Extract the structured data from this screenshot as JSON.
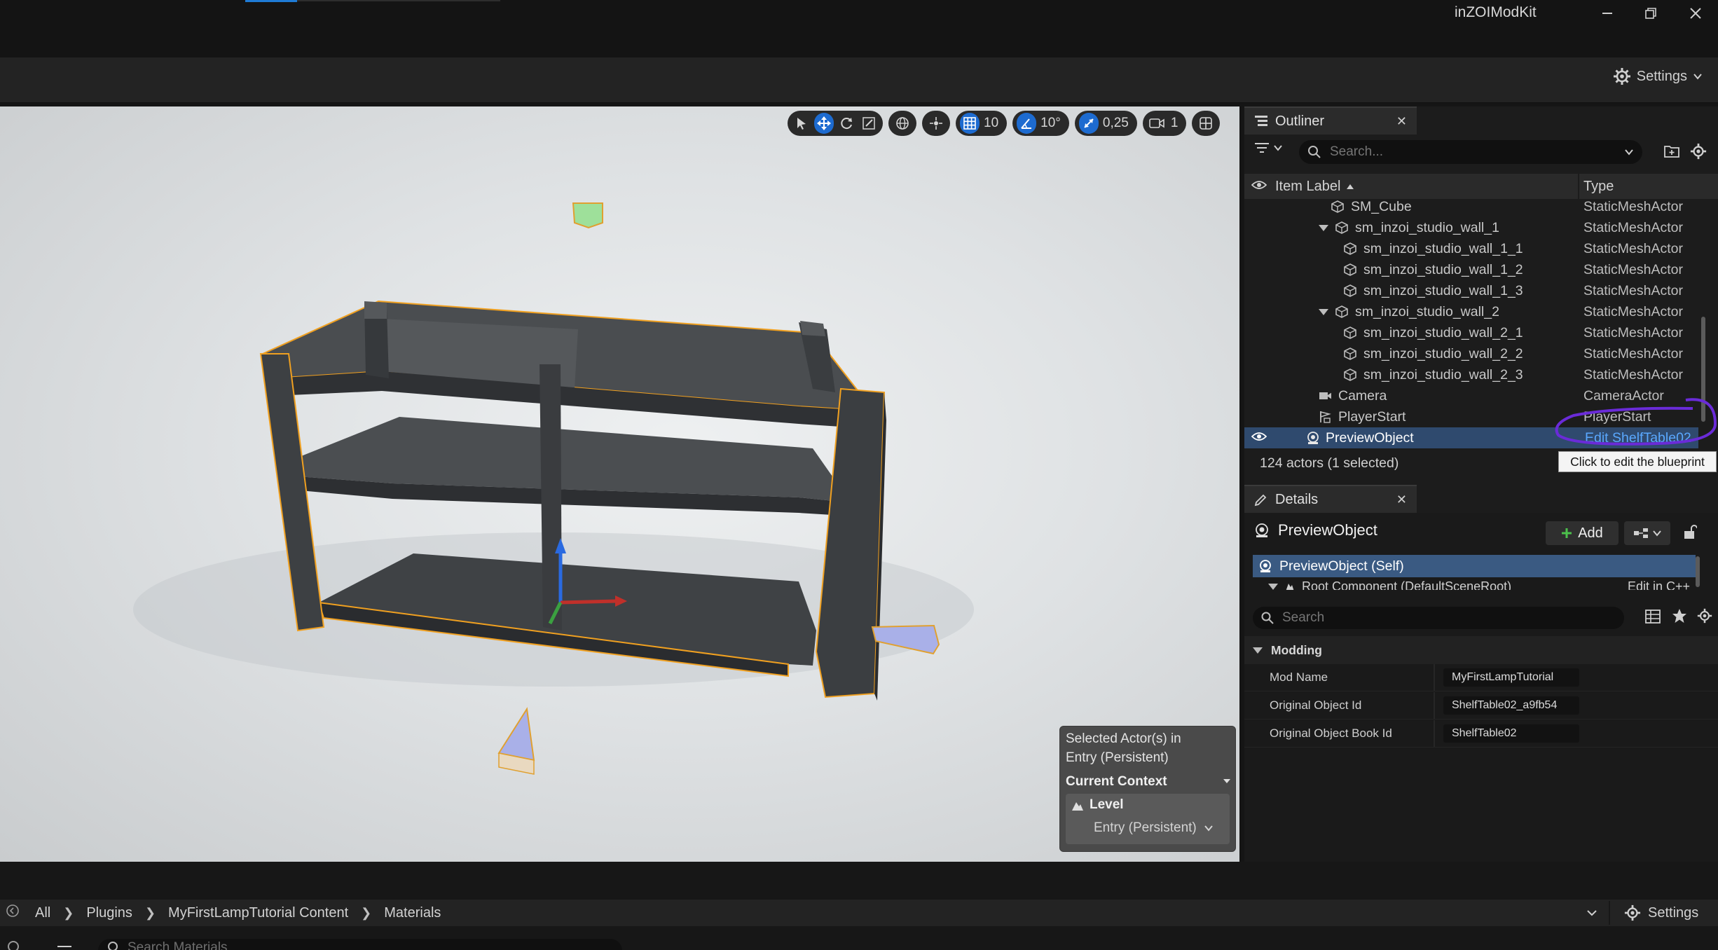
{
  "app": {
    "title": "inZOIModKit"
  },
  "toolbar": {
    "settings_label": "Settings"
  },
  "viewport_toolbar": {
    "grid_value": "10",
    "rotation_value": "10°",
    "scale_value": "0,25",
    "camera_speed": "1"
  },
  "level_context": {
    "info": "Selected Actor(s) in Entry (Persistent)",
    "current_context_label": "Current Context",
    "level_label": "Level",
    "level_value": "Entry (Persistent)"
  },
  "outliner": {
    "tab_label": "Outliner",
    "search_placeholder": "Search...",
    "col_label": "Item Label",
    "col_type": "Type",
    "rows": [
      {
        "label": "SM_Cube",
        "type": "StaticMeshActor"
      },
      {
        "label": "sm_inzoi_studio_wall_1",
        "type": "StaticMeshActor"
      },
      {
        "label": "sm_inzoi_studio_wall_1_1",
        "type": "StaticMeshActor"
      },
      {
        "label": "sm_inzoi_studio_wall_1_2",
        "type": "StaticMeshActor"
      },
      {
        "label": "sm_inzoi_studio_wall_1_3",
        "type": "StaticMeshActor"
      },
      {
        "label": "sm_inzoi_studio_wall_2",
        "type": "StaticMeshActor"
      },
      {
        "label": "sm_inzoi_studio_wall_2_1",
        "type": "StaticMeshActor"
      },
      {
        "label": "sm_inzoi_studio_wall_2_2",
        "type": "StaticMeshActor"
      },
      {
        "label": "sm_inzoi_studio_wall_2_3",
        "type": "StaticMeshActor"
      },
      {
        "label": "Camera",
        "type": "CameraActor"
      },
      {
        "label": "PlayerStart",
        "type": "PlayerStart"
      },
      {
        "label": "PreviewObject",
        "type": "Edit ShelfTable02"
      }
    ],
    "status": "124 actors (1 selected)",
    "tooltip": "Click to edit the blueprint"
  },
  "details": {
    "tab_label": "Details",
    "object_name": "PreviewObject",
    "add_label": "Add",
    "component_self": "PreviewObject (Self)",
    "component_root": "Root Component (DefaultSceneRoot)",
    "component_root_action": "Edit in C++",
    "search_placeholder": "Search",
    "section": "Modding",
    "props": [
      {
        "name": "Mod Name",
        "value": "MyFirstLampTutorial"
      },
      {
        "name": "Original Object Id",
        "value": "ShelfTable02_a9fb54"
      },
      {
        "name": "Original Object Book Id",
        "value": "ShelfTable02"
      }
    ]
  },
  "content_browser": {
    "breadcrumbs": [
      "All",
      "Plugins",
      "MyFirstLampTutorial Content",
      "Materials"
    ],
    "settings_label": "Settings",
    "search_placeholder": "Search Materials"
  },
  "colors": {
    "accent": "#1d6bd0",
    "selection": "#2f4a6e",
    "annotation": "#6a2bd8",
    "outline": "#f0a020"
  }
}
